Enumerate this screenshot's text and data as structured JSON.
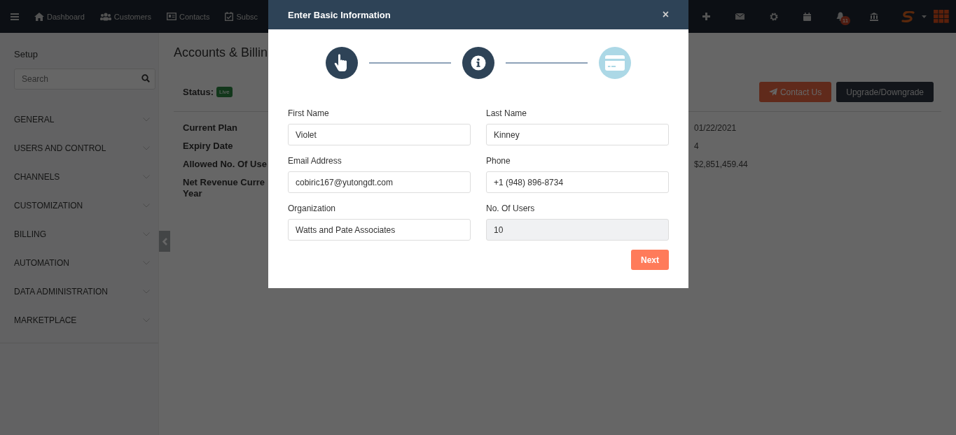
{
  "topbar": {
    "nav": [
      {
        "label": "Dashboard"
      },
      {
        "label": "Customers"
      },
      {
        "label": "Contacts"
      },
      {
        "label": "Subsc"
      }
    ],
    "notifications": "11"
  },
  "sidebar": {
    "title": "Setup",
    "search": {
      "placeholder": "Search"
    },
    "items": [
      {
        "label": "GENERAL",
        "expanded": false
      },
      {
        "label": "USERS AND CONTROL",
        "expanded": false
      },
      {
        "label": "CHANNELS",
        "expanded": false
      },
      {
        "label": "CUSTOMIZATION",
        "expanded": false
      },
      {
        "label": "BILLING",
        "expanded": false
      },
      {
        "label": "AUTOMATION",
        "expanded": false
      },
      {
        "label": "DATA ADMINISTRATION",
        "expanded": false
      },
      {
        "label": "MARKETPLACE",
        "expanded": false
      }
    ]
  },
  "page": {
    "title": "Accounts & Billin",
    "status_label": "Status:",
    "status": "Live",
    "buttons": [
      {
        "label": "Contact Us",
        "kind": "primary"
      },
      {
        "label": "Upgrade/Downgrade",
        "kind": "dark"
      }
    ],
    "rows": [
      {
        "label": [
          "Current Plan"
        ],
        "value": "01/22/2021"
      },
      {
        "label": [
          "Expiry Date"
        ],
        "value": "4"
      },
      {
        "label": [
          "Allowed No. Of Use"
        ],
        "value": "$2,851,459.44"
      },
      {
        "label": [
          "Net Revenue Curre",
          "Year"
        ]
      }
    ]
  },
  "modal": {
    "title": "Enter Basic Information",
    "close": "×",
    "steps": [
      {
        "done": true
      },
      {
        "done": true
      },
      {
        "done": false
      }
    ],
    "fields": [
      {
        "label": "First Name",
        "value": "Violet",
        "disabled": false
      },
      {
        "label": "Last Name",
        "value": "Kinney",
        "disabled": false
      },
      {
        "label": "Email Address",
        "value": "cobiric167@yutongdt.com",
        "disabled": false
      },
      {
        "label": "Phone",
        "value": "+1 (948) 896-8734",
        "disabled": false
      },
      {
        "label": "Organization",
        "value": "Watts and Pate Associates",
        "disabled": false
      },
      {
        "label": "No. Of Users",
        "value": "10",
        "disabled": true
      }
    ],
    "next": "Next"
  }
}
